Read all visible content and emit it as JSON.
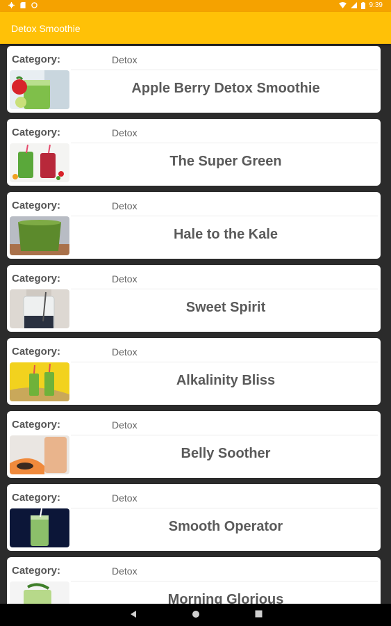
{
  "status_bar": {
    "time": "9:39",
    "icons_left": [
      "gear-icon",
      "sd-card-icon",
      "circle-icon"
    ],
    "icons_right": [
      "wifi-icon",
      "signal-icon",
      "battery-icon"
    ]
  },
  "app_bar": {
    "title": "Detox Smoothie"
  },
  "colors": {
    "status_bar": "#f5a200",
    "app_bar": "#ffc107",
    "background": "#2b2b2b",
    "card": "#ffffff"
  },
  "recipes": [
    {
      "category_label": "Category:",
      "category": "Detox",
      "name": "Apple Berry Detox Smoothie"
    },
    {
      "category_label": "Category:",
      "category": "Detox",
      "name": "The Super Green"
    },
    {
      "category_label": "Category:",
      "category": "Detox",
      "name": "Hale to the Kale"
    },
    {
      "category_label": "Category:",
      "category": "Detox",
      "name": "Sweet Spirit"
    },
    {
      "category_label": "Category:",
      "category": "Detox",
      "name": "Alkalinity Bliss"
    },
    {
      "category_label": "Category:",
      "category": "Detox",
      "name": "Belly Soother"
    },
    {
      "category_label": "Category:",
      "category": "Detox",
      "name": "Smooth Operator"
    },
    {
      "category_label": "Category:",
      "category": "Detox",
      "name": "Morning Glorious"
    }
  ],
  "nav_bar": {
    "icons": [
      "back-icon",
      "home-icon",
      "recents-icon"
    ]
  }
}
